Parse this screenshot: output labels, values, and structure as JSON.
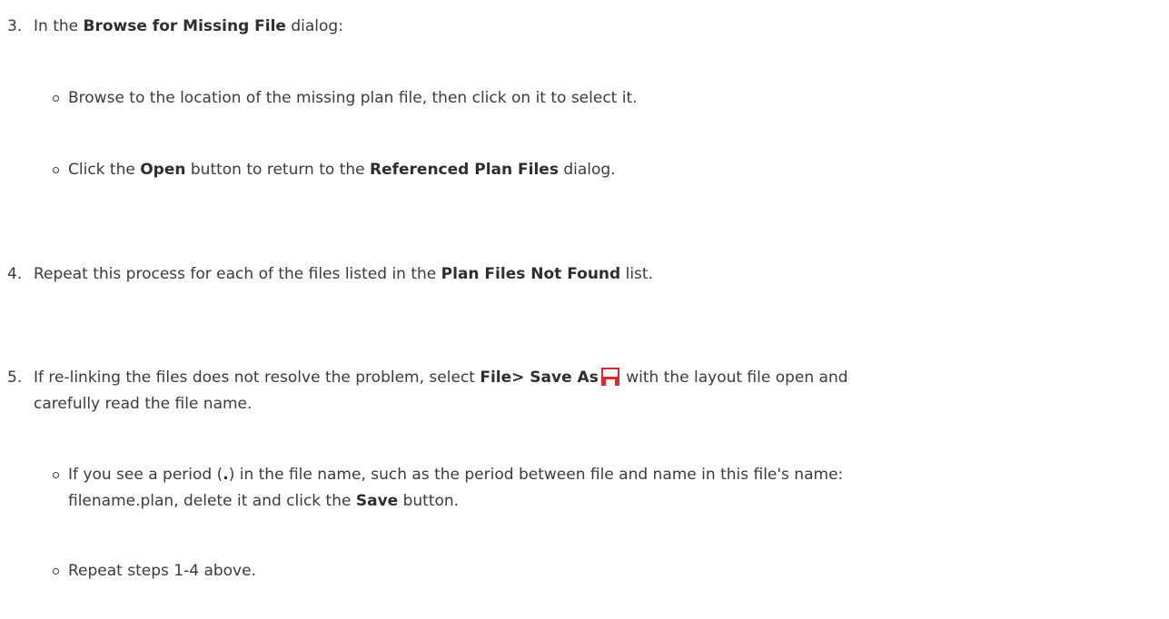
{
  "steps": {
    "s3": {
      "num": "3.",
      "pre": "In the ",
      "bold": "Browse for Missing File",
      "post": " dialog:",
      "subs": {
        "a": {
          "text": "Browse to the location of the missing plan file, then click on it to select it."
        },
        "b": {
          "pre": "Click the ",
          "bold1": "Open",
          "mid": " button to return to the ",
          "bold2": "Referenced Plan Files",
          "post": " dialog."
        }
      }
    },
    "s4": {
      "num": "4.",
      "pre": "Repeat this process for each of the files listed in the ",
      "bold": "Plan Files Not Found",
      "post": " list."
    },
    "s5": {
      "num": "5.",
      "pre": "If re-linking the files does not resolve the problem, select ",
      "bold": "File> Save As",
      "icon": "save-as-icon",
      "post": " with the layout file open and",
      "line2": "carefully read the file name.",
      "subs": {
        "a": {
          "line1_pre": "If you see a period (",
          "line1_bold": ".",
          "line1_post": ") in the file name, such as the period between file and name in this file's name:",
          "line2_pre": "filename.plan, delete it and click the ",
          "line2_bold": "Save",
          "line2_post": " button."
        },
        "b": {
          "text": "Repeat steps 1-4 above."
        }
      }
    }
  },
  "colors": {
    "text": "#3a3a3a",
    "icon_red": "#e0262b"
  }
}
